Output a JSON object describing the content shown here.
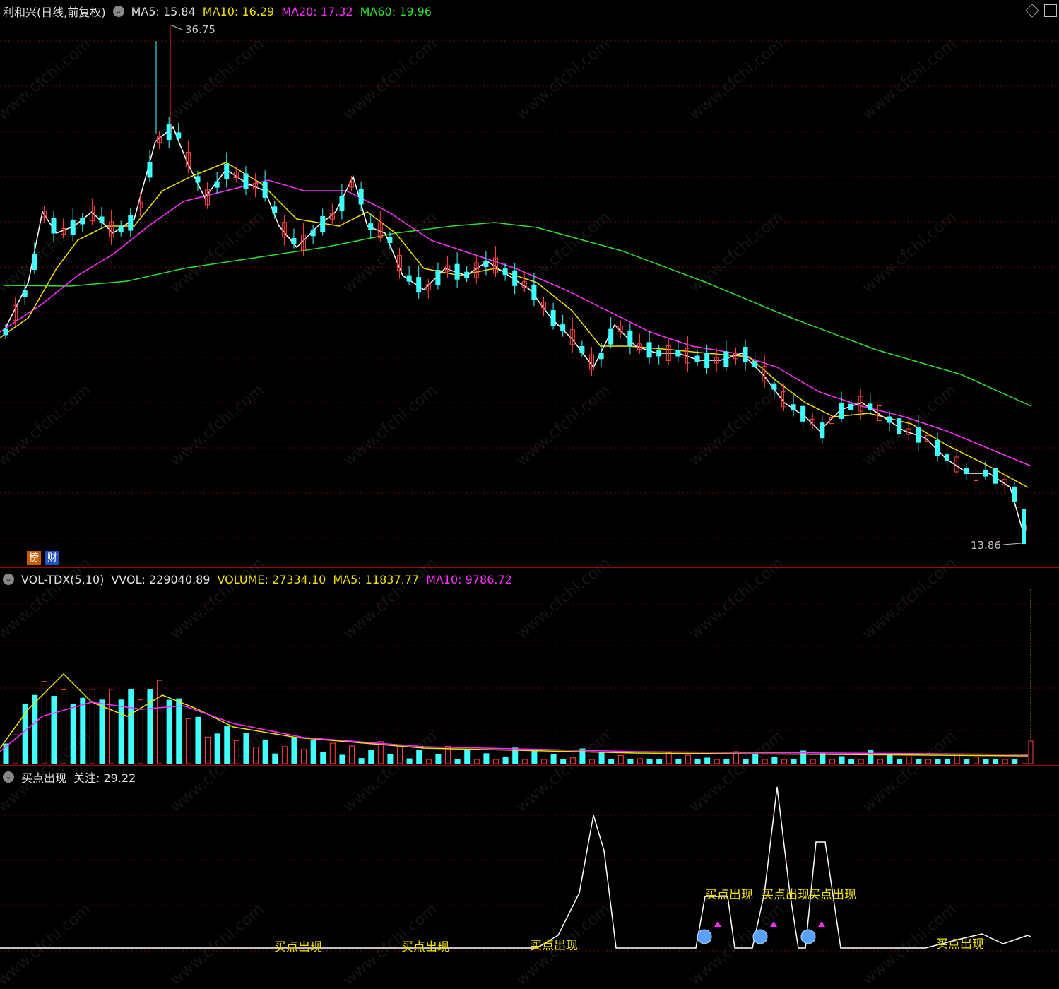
{
  "main": {
    "stock_name": "利和兴(日线,前复权)",
    "ma5_label": "MA5: 15.84",
    "ma10_label": "MA10: 16.29",
    "ma20_label": "MA20: 17.32",
    "ma60_label": "MA60: 19.96",
    "high_label": "36.75",
    "low_label": "13.86",
    "badge_bang": "榜",
    "badge_cai": "财"
  },
  "volume_panel": {
    "indicator": "VOL-TDX(5,10)",
    "vvol_label": "VVOL: 229040.89",
    "volume_label": "VOLUME: 27334.10",
    "ma5_label": "MA5: 11837.77",
    "ma10_label": "MA10: 9786.72"
  },
  "signal_panel": {
    "indicator": "买点出现",
    "focus_label": "关注: 29.22",
    "signal_text": "买点出现"
  },
  "watermark": "www.cfchi.com",
  "colors": {
    "up": "#ff4040",
    "down": "#40ffff",
    "ma5": "#ffffff",
    "ma10": "#f0e000",
    "ma20": "#ff30ff",
    "ma60": "#30e030",
    "grid": "#7a0000"
  }
}
